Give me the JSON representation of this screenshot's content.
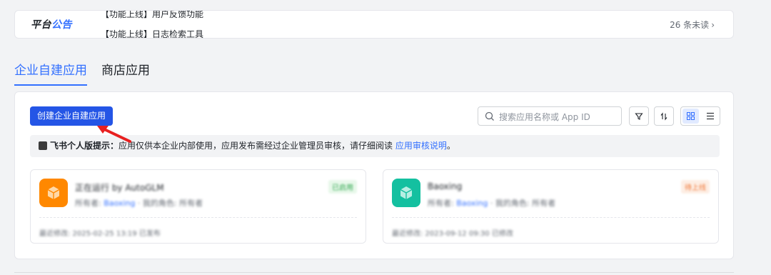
{
  "announcement": {
    "logo_part1": "平台",
    "logo_part2": "公告",
    "lines": [
      "【功能上线】用户反馈功能",
      "【功能上线】日志检索工具"
    ],
    "unread": "26 条未读"
  },
  "tabs": [
    {
      "label": "企业自建应用",
      "active": true
    },
    {
      "label": "商店应用",
      "active": false
    }
  ],
  "toolbar": {
    "create_label": "创建企业自建应用",
    "search_placeholder": "搜索应用名称或 App ID"
  },
  "tip": {
    "title": "飞书个人版提示：",
    "body": "应用仅供本企业内部使用，应用发布需经过企业管理员审核，请仔细阅读",
    "link": "应用审核说明",
    "end": "。"
  },
  "apps": [
    {
      "name": "正在运行 by AutoGLM",
      "owner_label": "所有者:",
      "owner": "Baoxing",
      "role": "我的角色: 所有者",
      "status": "已启用",
      "time": "最近修改: 2025-02-25 13:19 已发布",
      "icon_color": "#ff8800",
      "status_color": "#34a853",
      "status_bg": "#e8f8ea"
    },
    {
      "name": "Baoxing",
      "owner_label": "所有者:",
      "owner": "Baoxing",
      "role": "我的角色: 所有者",
      "status": "待上线",
      "time": "最近修改: 2023-09-12 09:30 已修改",
      "icon_color": "#14c0a0",
      "status_color": "#f07a3c",
      "status_bg": "#fdeee4"
    }
  ]
}
